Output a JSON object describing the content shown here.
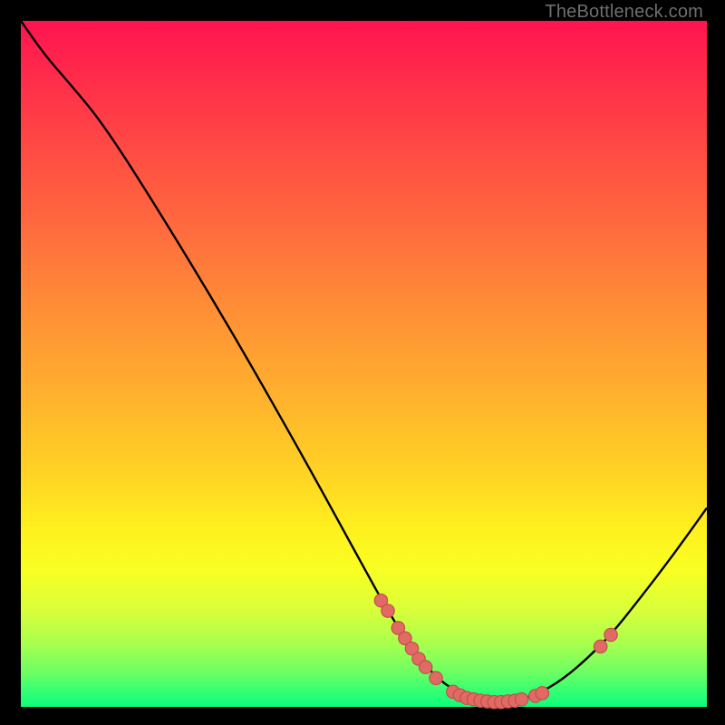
{
  "watermark": "TheBottleneck.com",
  "colors": {
    "background": "#000000",
    "curve_stroke": "#000000",
    "marker_fill": "#e26a65",
    "marker_stroke": "#c24f4a"
  },
  "chart_data": {
    "type": "line",
    "title": "",
    "xlabel": "",
    "ylabel": "",
    "xlim": [
      0,
      100
    ],
    "ylim": [
      0,
      100
    ],
    "grid": false,
    "legend": false,
    "curve": [
      {
        "x": 0.0,
        "y": 100.0
      },
      {
        "x": 3.5,
        "y": 95.0
      },
      {
        "x": 7.0,
        "y": 91.0
      },
      {
        "x": 12.0,
        "y": 85.0
      },
      {
        "x": 20.0,
        "y": 72.5
      },
      {
        "x": 30.0,
        "y": 56.0
      },
      {
        "x": 40.0,
        "y": 38.5
      },
      {
        "x": 48.0,
        "y": 24.0
      },
      {
        "x": 54.0,
        "y": 13.0
      },
      {
        "x": 58.5,
        "y": 6.5
      },
      {
        "x": 62.0,
        "y": 3.0
      },
      {
        "x": 66.0,
        "y": 1.2
      },
      {
        "x": 70.0,
        "y": 0.7
      },
      {
        "x": 74.0,
        "y": 1.3
      },
      {
        "x": 78.0,
        "y": 3.3
      },
      {
        "x": 82.0,
        "y": 6.5
      },
      {
        "x": 86.0,
        "y": 10.5
      },
      {
        "x": 90.0,
        "y": 15.5
      },
      {
        "x": 95.0,
        "y": 22.0
      },
      {
        "x": 100.0,
        "y": 29.0
      }
    ],
    "markers": [
      {
        "x": 52.5,
        "y": 15.5
      },
      {
        "x": 53.5,
        "y": 14.0
      },
      {
        "x": 55.0,
        "y": 11.5
      },
      {
        "x": 56.0,
        "y": 10.0
      },
      {
        "x": 57.0,
        "y": 8.5
      },
      {
        "x": 58.0,
        "y": 7.0
      },
      {
        "x": 59.0,
        "y": 5.8
      },
      {
        "x": 60.5,
        "y": 4.2
      },
      {
        "x": 63.0,
        "y": 2.2
      },
      {
        "x": 64.0,
        "y": 1.7
      },
      {
        "x": 65.0,
        "y": 1.3
      },
      {
        "x": 66.0,
        "y": 1.1
      },
      {
        "x": 67.0,
        "y": 0.9
      },
      {
        "x": 68.0,
        "y": 0.8
      },
      {
        "x": 69.0,
        "y": 0.7
      },
      {
        "x": 70.0,
        "y": 0.7
      },
      {
        "x": 71.0,
        "y": 0.8
      },
      {
        "x": 72.0,
        "y": 0.9
      },
      {
        "x": 73.0,
        "y": 1.1
      },
      {
        "x": 75.0,
        "y": 1.6
      },
      {
        "x": 76.0,
        "y": 2.0
      },
      {
        "x": 84.5,
        "y": 8.8
      },
      {
        "x": 86.0,
        "y": 10.5
      }
    ]
  }
}
